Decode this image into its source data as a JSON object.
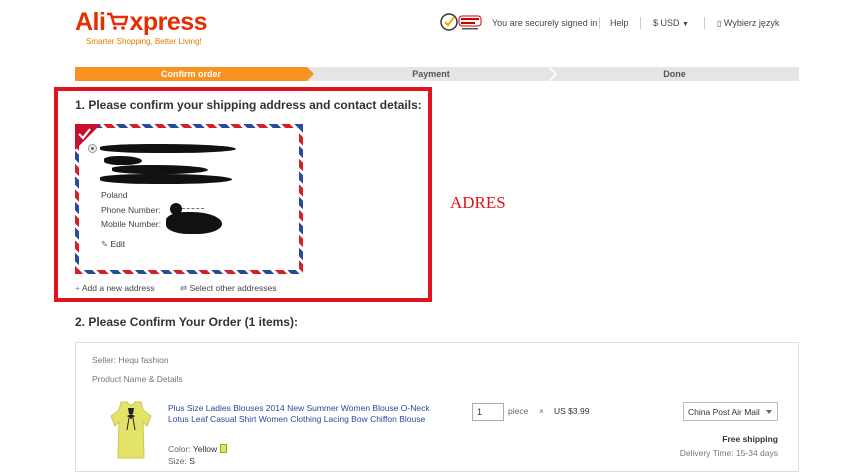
{
  "header": {
    "logo_text_1": "Ali",
    "logo_text_2": "xpress",
    "tagline": "Smarter Shopping, Better Living!",
    "signed_in": "You are securely signed in",
    "help": "Help",
    "currency": "$ USD",
    "language": "Wybierz język",
    "badge_label": "Norton Secured"
  },
  "steps": [
    "Confirm order",
    "Payment",
    "Done"
  ],
  "section1": {
    "title": "1. Please confirm your shipping address and contact details:",
    "country": "Poland",
    "phone_label": "Phone Number:",
    "mobile_label": "Mobile Number:",
    "edit": "Edit",
    "add_new": "Add a new address",
    "select_other": "Select other addresses",
    "annotation": "ADRES"
  },
  "section2": {
    "title": "2. Please Confirm Your Order (1 items):",
    "seller": "Seller: Hequ fashion",
    "product_header": "Product Name & Details",
    "product_title": "Plus Size Ladies Blouses 2014 New Summer Women Blouse O-Neck Lotus Leaf Casual Shirt Women Clothing Lacing Bow Chiffon Blouse",
    "color_label": "Color:",
    "color_value": "Yellow",
    "size_label": "Size:",
    "size_value": "S",
    "quantity": "1",
    "piece": "piece",
    "times": "×",
    "price": "US $3.99",
    "shipping_method": "China Post Air Mail",
    "free_shipping": "Free shipping",
    "delivery": "Delivery Time:  15-34 days"
  },
  "colors": {
    "accent": "#f7931e",
    "brand": "#e62e04",
    "highlight": "#e0141c"
  }
}
